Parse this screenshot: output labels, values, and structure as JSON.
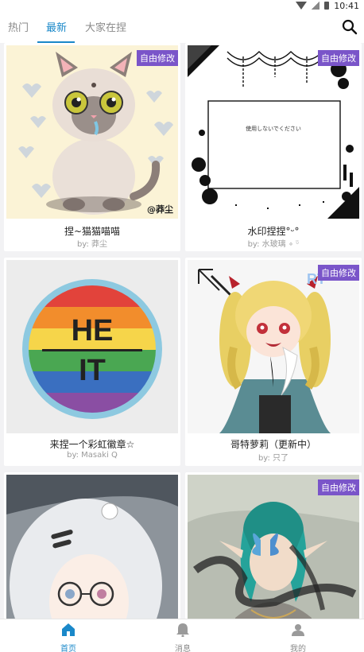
{
  "status": {
    "time": "10:41"
  },
  "tabs": [
    {
      "label": "热门"
    },
    {
      "label": "最新"
    },
    {
      "label": "大家在捏"
    }
  ],
  "cards": [
    {
      "title": "捏~猫猫喵喵",
      "author": "by: 莽尘",
      "badge": "自由修改",
      "signature": "@莽尘"
    },
    {
      "title": "水印捏捏°ᵕ°",
      "author": "by: 水玻璃 ∘ ᵕ̈",
      "badge": "自由修改",
      "frame_text": "使用しないでください"
    },
    {
      "title": "来捏一个彩虹徽章☆",
      "author": "by: Masaki Q",
      "emblem_top": "HE",
      "emblem_bottom": "IT"
    },
    {
      "title": "哥特萝莉（更新中）",
      "author": "by: 只了",
      "badge": "自由修改"
    },
    {
      "badge": ""
    },
    {
      "badge": "自由修改"
    }
  ],
  "nav": [
    {
      "label": "首页",
      "icon": "home-icon"
    },
    {
      "label": "消息",
      "icon": "bell-icon"
    },
    {
      "label": "我的",
      "icon": "person-icon"
    }
  ],
  "colors": {
    "accent": "#1a88c9",
    "badge": "#7a55c9"
  }
}
